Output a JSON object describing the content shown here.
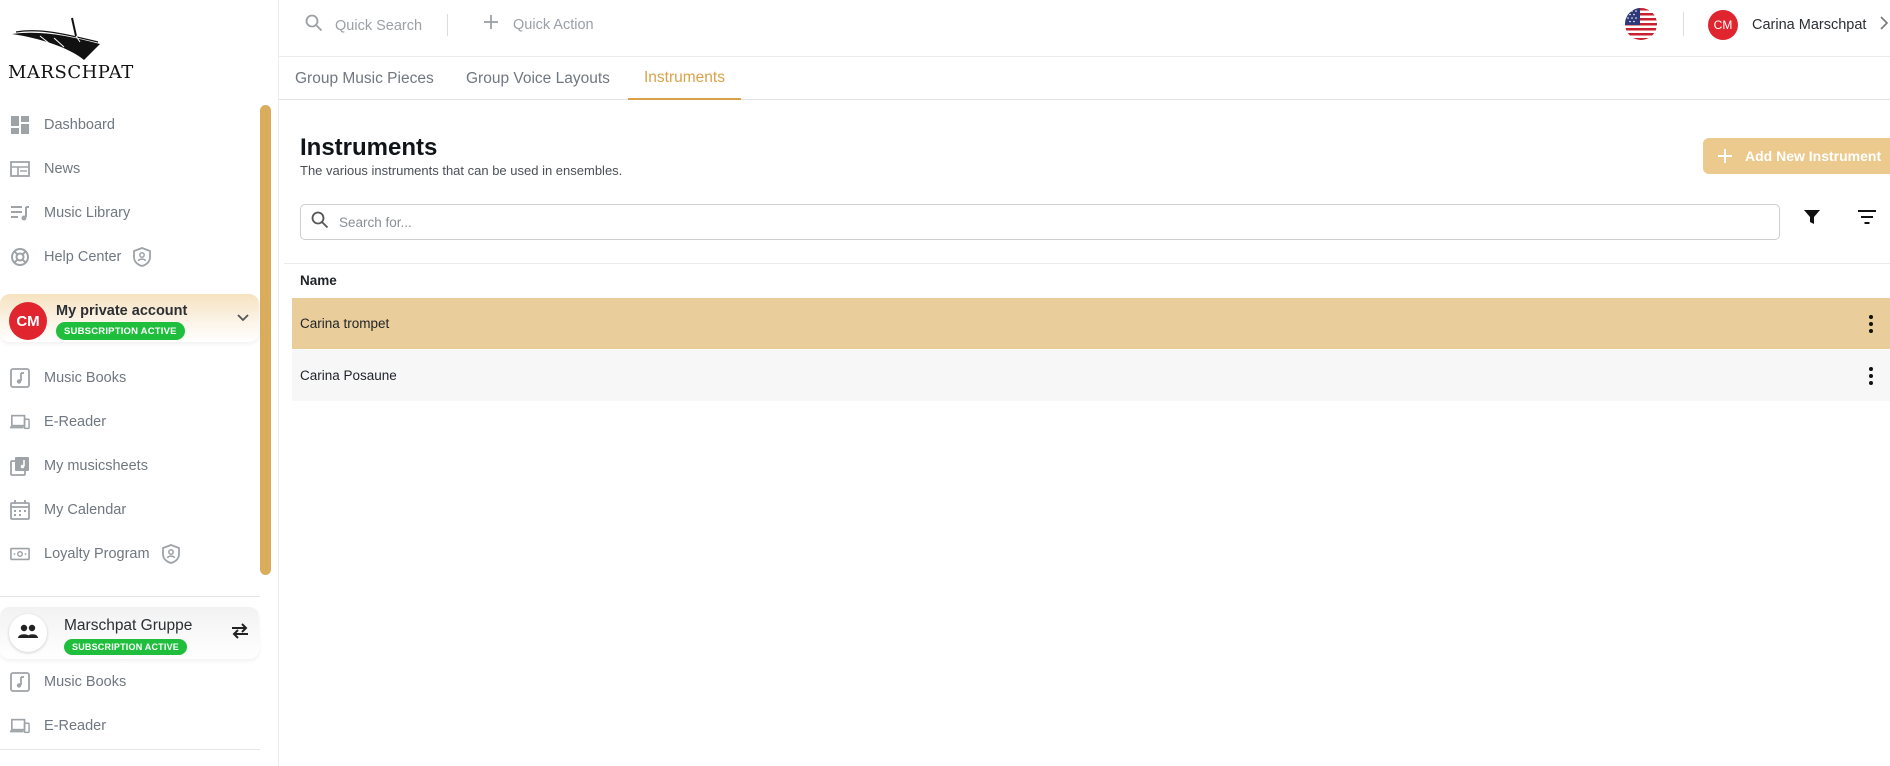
{
  "app": {
    "logo_text": "MARSCHPAT"
  },
  "topbar": {
    "quick_search": "Quick Search",
    "quick_action": "Quick Action",
    "language_flag": "us-flag-icon",
    "user": {
      "initials": "CM",
      "name": "Carina Marschpat"
    }
  },
  "sidebar": {
    "main_items": [
      {
        "label": "Dashboard",
        "icon": "dashboard-icon"
      },
      {
        "label": "News",
        "icon": "news-icon"
      },
      {
        "label": "Music Library",
        "icon": "music-library-icon"
      },
      {
        "label": "Help Center",
        "icon": "help-center-icon",
        "shield": true
      }
    ],
    "account": {
      "initials": "CM",
      "name": "My private account",
      "badge": "SUBSCRIPTION ACTIVE"
    },
    "account_items": [
      {
        "label": "Music Books",
        "icon": "music-book-icon"
      },
      {
        "label": "E-Reader",
        "icon": "e-reader-icon"
      },
      {
        "label": "My musicsheets",
        "icon": "musicsheets-icon"
      },
      {
        "label": "My Calendar",
        "icon": "calendar-icon"
      },
      {
        "label": "Loyalty Program",
        "icon": "loyalty-icon",
        "shield": true
      }
    ],
    "group": {
      "name": "Marschpat Gruppe",
      "badge": "SUBSCRIPTION ACTIVE"
    },
    "group_items": [
      {
        "label": "Music Books",
        "icon": "music-book-icon"
      },
      {
        "label": "E-Reader",
        "icon": "e-reader-icon"
      }
    ]
  },
  "tabs": [
    {
      "label": "Group Music Pieces",
      "active": false
    },
    {
      "label": "Group Voice Layouts",
      "active": false
    },
    {
      "label": "Instruments",
      "active": true
    }
  ],
  "main": {
    "title": "Instruments",
    "subtitle": "The various instruments that can be used in ensembles.",
    "add_button": "Add New Instrument",
    "search_placeholder": "Search for...",
    "table": {
      "header": "Name",
      "rows": [
        "Carina trompet",
        "Carina Posaune"
      ]
    }
  },
  "colors": {
    "accent": "#d9a24a",
    "selected_row": "#e9cd9b",
    "add_button": "#ecc98c",
    "badge_green": "#1fbf3d",
    "avatar_red": "#e0252f"
  }
}
